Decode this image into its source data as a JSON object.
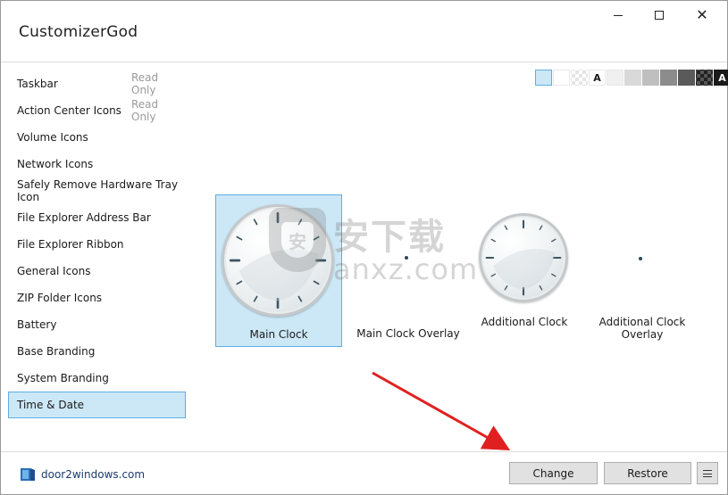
{
  "app": {
    "title": "CustomizerGod"
  },
  "window_controls": {
    "minimize": "minimize",
    "maximize": "maximize",
    "close": "close"
  },
  "sidebar": {
    "items": [
      {
        "label": "Taskbar",
        "badge": "Read Only",
        "selected": false
      },
      {
        "label": "Action Center Icons",
        "badge": "Read Only",
        "selected": false
      },
      {
        "label": "Volume Icons",
        "badge": "",
        "selected": false
      },
      {
        "label": "Network Icons",
        "badge": "",
        "selected": false
      },
      {
        "label": "Safely Remove Hardware Tray Icon",
        "badge": "",
        "selected": false
      },
      {
        "label": "File Explorer Address Bar",
        "badge": "",
        "selected": false
      },
      {
        "label": "File Explorer Ribbon",
        "badge": "",
        "selected": false
      },
      {
        "label": "General Icons",
        "badge": "",
        "selected": false
      },
      {
        "label": "ZIP Folder Icons",
        "badge": "",
        "selected": false
      },
      {
        "label": "Battery",
        "badge": "",
        "selected": false
      },
      {
        "label": "Base Branding",
        "badge": "",
        "selected": false
      },
      {
        "label": "System Branding",
        "badge": "",
        "selected": false
      },
      {
        "label": "Time & Date",
        "badge": "",
        "selected": true
      }
    ]
  },
  "background_swatches": [
    {
      "kind": "light-blue",
      "color": "#cce8f7",
      "active": true
    },
    {
      "kind": "white",
      "color": "#ffffff"
    },
    {
      "kind": "checker-light",
      "color": "#e4e4e4"
    },
    {
      "kind": "letter-light",
      "color": "#ffffff",
      "letter": "A"
    },
    {
      "kind": "very-light-gray",
      "color": "#f0f0f0"
    },
    {
      "kind": "light-gray",
      "color": "#d9d9d9"
    },
    {
      "kind": "gray",
      "color": "#bfbfbf"
    },
    {
      "kind": "mid-gray",
      "color": "#8c8c8c"
    },
    {
      "kind": "dark-gray",
      "color": "#5a5a5a"
    },
    {
      "kind": "checker-dark",
      "color": "#222222"
    },
    {
      "kind": "letter-dark",
      "color": "#1a1a1a",
      "letter": "A"
    },
    {
      "kind": "black",
      "color": "#000000"
    }
  ],
  "tiles": [
    {
      "label": "Main Clock",
      "selected": true,
      "icon": "clock-icon"
    },
    {
      "label": "Main Clock Overlay",
      "selected": false,
      "icon": "clock-overlay-icon"
    },
    {
      "label": "Additional Clock",
      "selected": false,
      "icon": "clock-icon"
    },
    {
      "label": "Additional Clock Overlay",
      "selected": false,
      "icon": "clock-overlay-icon"
    }
  ],
  "watermark": {
    "cn": "安下载",
    "en": "anxz.com",
    "shield_glyph": "安"
  },
  "footer": {
    "brand": "door2windows.com",
    "change_label": "Change",
    "restore_label": "Restore",
    "menu_icon": "hamburger-icon"
  },
  "colors": {
    "selection_bg": "#cce8f7",
    "selection_border": "#5faee3",
    "arrow": "#e02020"
  }
}
